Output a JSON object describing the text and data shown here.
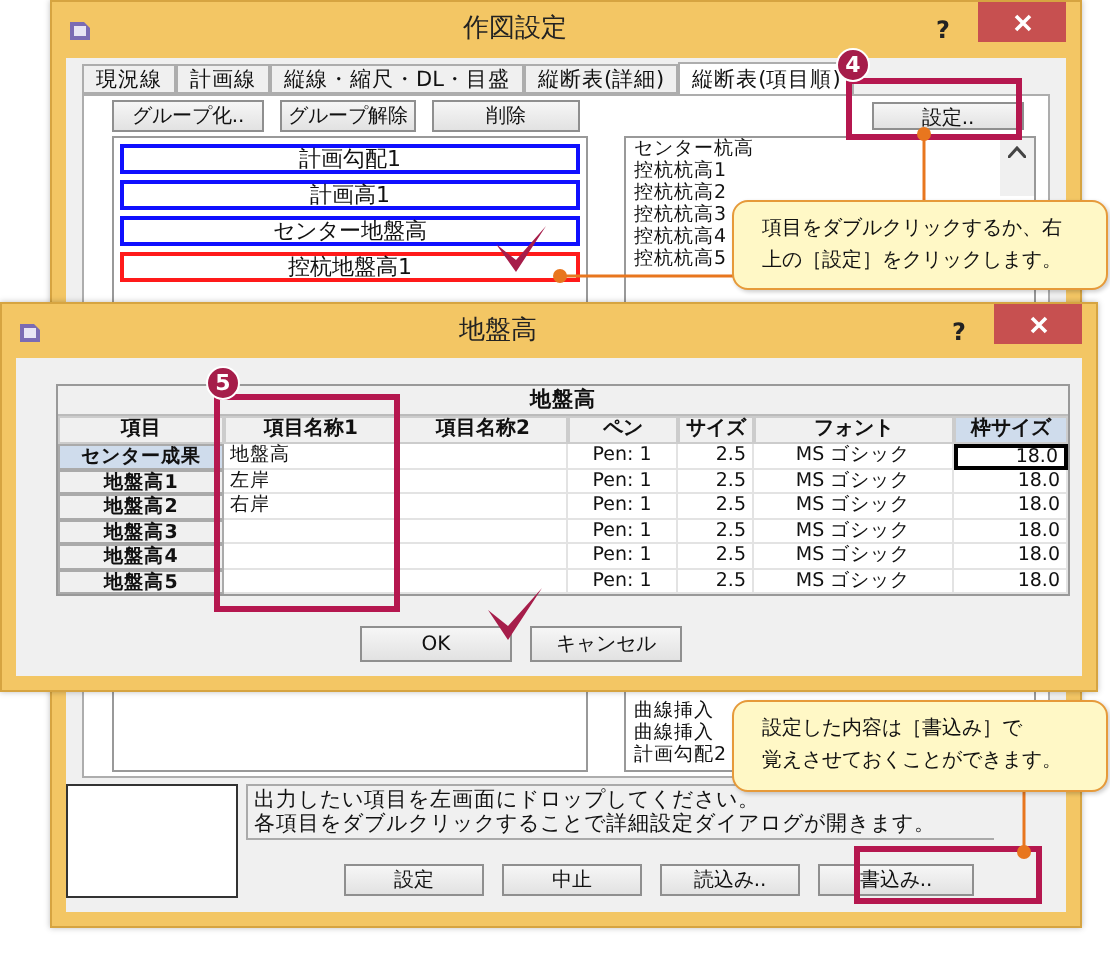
{
  "main_window": {
    "title": "作図設定",
    "help_label": "?",
    "tabs": [
      {
        "label": "現況線",
        "selected": false
      },
      {
        "label": "計画線",
        "selected": false
      },
      {
        "label": "縦線・縮尺・DL・目盛",
        "selected": false
      },
      {
        "label": "縦断表(詳細)",
        "selected": false
      },
      {
        "label": "縦断表(項目順)",
        "selected": true
      }
    ],
    "toolbar_buttons": [
      "グループ化..",
      "グループ解除",
      "削除"
    ],
    "settings_button": "設定..",
    "group_items": [
      {
        "label": "計画勾配1",
        "selected": false
      },
      {
        "label": "計画高1",
        "selected": false
      },
      {
        "label": "センター地盤高",
        "selected": false
      },
      {
        "label": "控杭地盤高1",
        "selected": true
      }
    ],
    "item_list_top": [
      "センター杭高",
      "控杭杭高1",
      "控杭杭高2",
      "控杭杭高3",
      "控杭杭高4",
      "控杭杭高5"
    ],
    "item_list_bottom": [
      "曲線挿入",
      "曲線挿入",
      "計画勾配2"
    ],
    "message": [
      "出力したい項目を左画面にドロップしてください。",
      "各項目をダブルクリックすることで詳細設定ダイアログが開きます。"
    ],
    "buttons": [
      "設定",
      "中止",
      "読込み..",
      "書込み.."
    ]
  },
  "dialog": {
    "title": "地盤高",
    "help_label": "?",
    "group_header": "地盤高",
    "columns": [
      "項目",
      "項目名称1",
      "項目名称2",
      "ペン",
      "サイズ",
      "フォント",
      "枠サイズ"
    ],
    "rows": [
      {
        "label": "センター成果",
        "selected": true,
        "name_1": "地盤高",
        "pen": "Pen: 1",
        "size": "2.5",
        "font": "MS ゴシック",
        "frame_size": "18.0"
      },
      {
        "label": "地盤高1",
        "selected": false,
        "name_1": "左岸",
        "pen": "Pen: 1",
        "size": "2.5",
        "font": "MS ゴシック",
        "frame_size": "18.0"
      },
      {
        "label": "地盤高2",
        "selected": false,
        "name_1": "右岸",
        "pen": "Pen: 1",
        "size": "2.5",
        "font": "MS ゴシック",
        "frame_size": "18.0"
      },
      {
        "label": "地盤高3",
        "selected": false,
        "pen": "Pen: 1",
        "size": "2.5",
        "font": "MS ゴシック",
        "frame_size": "18.0"
      },
      {
        "label": "地盤高4",
        "selected": false,
        "pen": "Pen: 1",
        "size": "2.5",
        "font": "MS ゴシック",
        "frame_size": "18.0"
      },
      {
        "label": "地盤高5",
        "selected": false,
        "pen": "Pen: 1",
        "size": "2.5",
        "font": "MS ゴシック",
        "frame_size": "18.0"
      }
    ],
    "buttons": [
      "OK",
      "キャンセル"
    ]
  },
  "steps": [
    {
      "number": "4"
    },
    {
      "number": "5"
    }
  ],
  "callouts": [
    {
      "lines": [
        "項目をダブルクリックするか、右",
        "上の［設定］をクリックします。"
      ]
    },
    {
      "lines": [
        "設定した内容は［書込み］で",
        "覚えさせておくことができます。"
      ]
    }
  ]
}
